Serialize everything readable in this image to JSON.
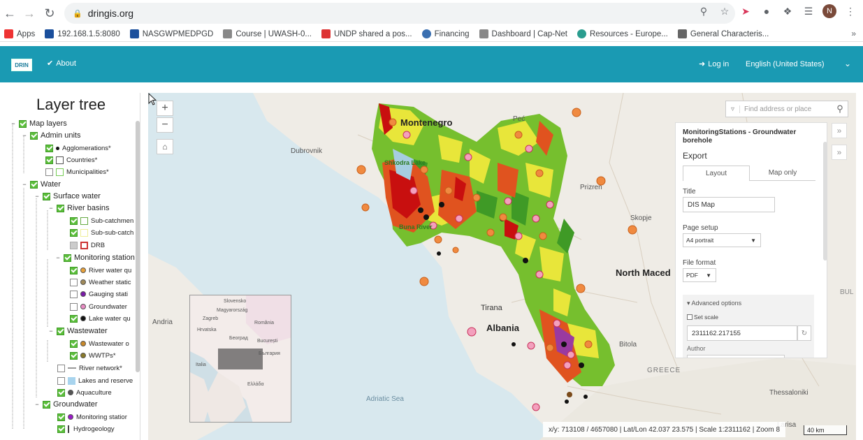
{
  "browser": {
    "url": "dringis.org",
    "profile_initial": "N",
    "bookmarks": [
      {
        "label": "Apps"
      },
      {
        "label": "192.168.1.5:8080"
      },
      {
        "label": "NASGWPMEDPGD"
      },
      {
        "label": "Course | UWASH-0..."
      },
      {
        "label": "UNDP shared a pos..."
      },
      {
        "label": "Financing"
      },
      {
        "label": "Dashboard | Cap-Net"
      },
      {
        "label": "Resources - Europe..."
      },
      {
        "label": "General Characteris..."
      }
    ],
    "more": "»"
  },
  "header": {
    "logo_text": "DRIN",
    "about": "About",
    "login": "Log in",
    "language": "English (United States)",
    "brand_color": "#1a9ab3"
  },
  "layer_tree": {
    "title": "Layer tree",
    "items": [
      {
        "label": "Map layers"
      },
      {
        "label": "Admin units"
      },
      {
        "label": "Agglomerations*"
      },
      {
        "label": "Countries*"
      },
      {
        "label": "Municipalities*"
      },
      {
        "label": "Water"
      },
      {
        "label": "Surface water"
      },
      {
        "label": "River basins"
      },
      {
        "label": "Sub-catchmen"
      },
      {
        "label": "Sub-sub-catch"
      },
      {
        "label": "DRB"
      },
      {
        "label": "Monitoring station"
      },
      {
        "label": "River water qu"
      },
      {
        "label": "Weather static"
      },
      {
        "label": "Gauging stati"
      },
      {
        "label": "Groundwater"
      },
      {
        "label": "Lake water qu"
      },
      {
        "label": "Wastewater"
      },
      {
        "label": "Wastewater o"
      },
      {
        "label": "WWTPs*"
      },
      {
        "label": "River network*"
      },
      {
        "label": "Lakes and reserve"
      },
      {
        "label": "Aquaculture"
      },
      {
        "label": "Groundwater"
      },
      {
        "label": "Monitoring statior"
      },
      {
        "label": "Hydrogeology"
      }
    ]
  },
  "map": {
    "search_placeholder": "Find address or place",
    "zoom_in": "+",
    "zoom_out": "−",
    "labels": {
      "montenegro": "Montenegro",
      "albania": "Albania",
      "north_macedonia": "North Maced",
      "tirana": "Tirana",
      "skopje": "Skopje",
      "dubrovnik": "Dubrovnik",
      "andria": "Andria",
      "adriatic": "Adriatic\nSea",
      "greece": "GREECE",
      "shkodra_lake": "Shkodra Lake",
      "buna_river": "Buna River",
      "bitola": "Bitola",
      "thessaloniki": "Thessaloniki",
      "kosovo": "Prizren",
      "pec": "Peć",
      "larisa": "Larisa",
      "bul": "BUL"
    },
    "inset_labels": {
      "slovensko": "Slovensko",
      "magyarorszag": "Magyarország",
      "zagreb": "Zagreb",
      "romania": "România",
      "hrvatska": "Hrvatska",
      "bucuresti": "București",
      "beograd": "Београд",
      "italia": "Italia",
      "balgaria": "България",
      "ellada": "Ελλάδα"
    },
    "coords": "x/y: 713108 / 4657080 | Lat/Lon 42.037 23.575 | Scale 1:2311162 | Zoom 8",
    "scale": "40 km"
  },
  "export": {
    "heading": "MonitoringStations - Groundwater borehole",
    "title": "Export",
    "tab_layout": "Layout",
    "tab_map_only": "Map only",
    "title_label": "Title",
    "title_value": "DIS Map",
    "page_setup_label": "Page setup",
    "page_setup_value": "A4 portrait",
    "file_format_label": "File format",
    "file_format_value": "PDF",
    "advanced_label": "Advanced options",
    "set_scale_label": "Set scale",
    "scale_value": "2311162.217155",
    "author_label": "Author"
  }
}
